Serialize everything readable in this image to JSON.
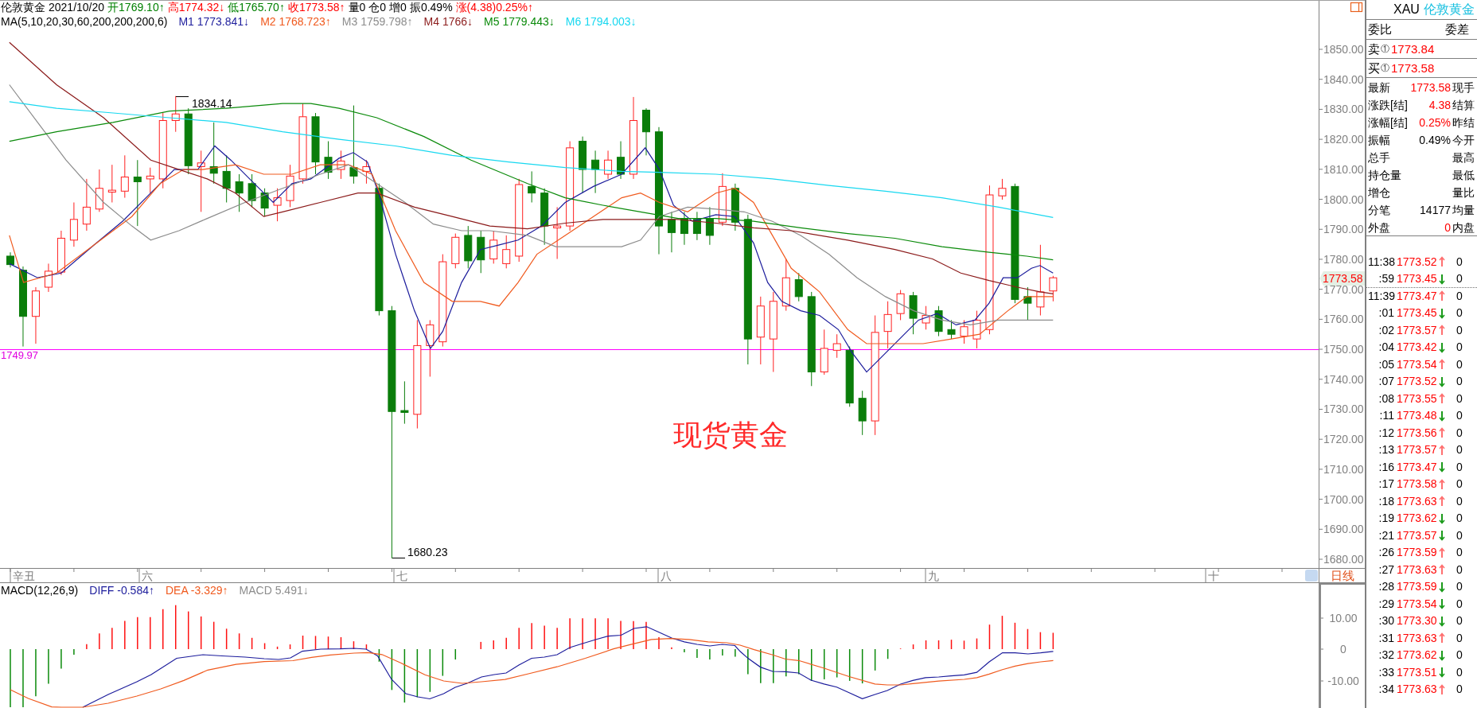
{
  "chart_header": {
    "symbol": "伦敦黄金",
    "date": "2021/10/20",
    "quotes": [
      {
        "text": "开1769.10↑",
        "color": "#008000"
      },
      {
        "text": "高1774.32↓",
        "color": "#ff0000"
      },
      {
        "text": "低1765.70↑",
        "color": "#008000"
      },
      {
        "text": "收1773.58↑",
        "color": "#ff0000"
      },
      {
        "text": "量0",
        "color": "#000000"
      },
      {
        "text": "仓0",
        "color": "#000000"
      },
      {
        "text": "增0",
        "color": "#000000"
      },
      {
        "text": "振0.49%",
        "color": "#000000"
      },
      {
        "text": "涨(4.38)0.25%↑",
        "color": "#ff0000"
      }
    ]
  },
  "ma_legend": {
    "title": "MA(5,10,20,30,60,200,200,200,6)",
    "items": [
      {
        "text": "M1 1773.841↓",
        "color": "#1c1c9c"
      },
      {
        "text": "M2 1768.723↑",
        "color": "#f05a1e"
      },
      {
        "text": "M3 1759.798↑",
        "color": "#8c8c8c"
      },
      {
        "text": "M4 1766↓",
        "color": "#8b1a1a"
      },
      {
        "text": "M5 1779.443↓",
        "color": "#0a8a0a"
      },
      {
        "text": "M6 1794.003↓",
        "color": "#18d8f0"
      }
    ]
  },
  "price_chart": {
    "high_label": "1834.14",
    "low_label": "1680.23",
    "reference_label": "1749.97",
    "title": "现货黄金"
  },
  "price_axis": {
    "labels": [
      "1850.00",
      "1840.00",
      "1830.00",
      "1820.00",
      "1810.00",
      "1800.00",
      "1790.00",
      "1780.00",
      "1770.00",
      "1760.00",
      "1750.00",
      "1740.00",
      "1730.00",
      "1720.00",
      "1710.00",
      "1700.00",
      "1690.00",
      "1680.00"
    ],
    "current_price": "1773.58"
  },
  "date_axis": {
    "labels": [
      "辛丑",
      "六",
      "七",
      "八",
      "九",
      "十"
    ],
    "period": "日线"
  },
  "macd_legend": {
    "title": "MACD(12,26,9)",
    "items": [
      {
        "text": "DIFF -0.584↑",
        "color": "#1c1c9c"
      },
      {
        "text": "DEA -3.329↑",
        "color": "#f05a1e"
      },
      {
        "text": "MACD 5.491↓",
        "color": "#8c8c8c"
      }
    ]
  },
  "macd_axis": {
    "labels": [
      "10.00",
      "0",
      "-10.00"
    ]
  },
  "quote_panel": {
    "symbol": "XAU",
    "name": "伦敦黄金",
    "order_header": [
      "委比",
      "委差"
    ],
    "order_book": [
      {
        "side": "卖",
        "mark": "①",
        "price": "1773.84"
      },
      {
        "side": "买",
        "mark": "①",
        "price": "1773.58"
      }
    ],
    "stats": [
      {
        "label": "最新",
        "value": "1773.58",
        "color": "#ff0000",
        "right_label": "现手"
      },
      {
        "label": "涨跌[结]",
        "value": "4.38",
        "color": "#ff0000",
        "right_label": "结算"
      },
      {
        "label": "涨幅[结]",
        "value": "0.25%",
        "color": "#ff0000",
        "right_label": "昨结"
      },
      {
        "label": "振幅",
        "value": "0.49%",
        "color": "#000000",
        "right_label": "今开"
      },
      {
        "label": "总手",
        "right_label": "最高"
      },
      {
        "label": "持仓量",
        "right_label": "最低"
      },
      {
        "label": "增仓",
        "right_label": "量比"
      },
      {
        "label": "分笔",
        "value": "14177",
        "color": "#000000",
        "right_label": "均量"
      },
      {
        "label": "外盘",
        "value": "0",
        "color": "#ff0000",
        "right_label": "内盘"
      }
    ],
    "ticks": [
      {
        "time": "11:38",
        "price": "1773.52",
        "kind": "up",
        "color": "#ff7070",
        "volume": "0",
        "separated": false
      },
      {
        "time": ":59",
        "price": "1773.45",
        "kind": "down",
        "color": "#1a9a1a",
        "volume": "0",
        "separated": false
      },
      {
        "time": "11:39",
        "price": "1773.47",
        "kind": "up",
        "color": "#ff7070",
        "volume": "0",
        "separated": true
      },
      {
        "time": ":01",
        "price": "1773.45",
        "kind": "down",
        "color": "#1a9a1a",
        "volume": "0",
        "separated": false
      },
      {
        "time": ":02",
        "price": "1773.57",
        "kind": "up",
        "color": "#ff7070",
        "volume": "0",
        "separated": false
      },
      {
        "time": ":04",
        "price": "1773.42",
        "kind": "down",
        "color": "#1a9a1a",
        "volume": "0",
        "separated": false
      },
      {
        "time": ":05",
        "price": "1773.54",
        "kind": "up",
        "color": "#ff7070",
        "volume": "0",
        "separated": false
      },
      {
        "time": ":07",
        "price": "1773.52",
        "kind": "down",
        "color": "#1a9a1a",
        "volume": "0",
        "separated": false
      },
      {
        "time": ":08",
        "price": "1773.55",
        "kind": "up",
        "color": "#ff7070",
        "volume": "0",
        "separated": false
      },
      {
        "time": ":11",
        "price": "1773.48",
        "kind": "down",
        "color": "#1a9a1a",
        "volume": "0",
        "separated": false
      },
      {
        "time": ":12",
        "price": "1773.56",
        "kind": "up",
        "color": "#ff7070",
        "volume": "0",
        "separated": false
      },
      {
        "time": ":13",
        "price": "1773.57",
        "kind": "up",
        "color": "#ff7070",
        "volume": "0",
        "separated": false
      },
      {
        "time": ":16",
        "price": "1773.47",
        "kind": "down",
        "color": "#1a9a1a",
        "volume": "0",
        "separated": false
      },
      {
        "time": ":17",
        "price": "1773.58",
        "kind": "up",
        "color": "#ff7070",
        "volume": "0",
        "separated": false
      },
      {
        "time": ":18",
        "price": "1773.63",
        "kind": "up",
        "color": "#ff7070",
        "volume": "0",
        "separated": false
      },
      {
        "time": ":19",
        "price": "1773.62",
        "kind": "down",
        "color": "#1a9a1a",
        "volume": "0",
        "separated": false
      },
      {
        "time": ":21",
        "price": "1773.57",
        "kind": "down",
        "color": "#1a9a1a",
        "volume": "0",
        "separated": false
      },
      {
        "time": ":26",
        "price": "1773.59",
        "kind": "up",
        "color": "#ff7070",
        "volume": "0",
        "separated": false
      },
      {
        "time": ":27",
        "price": "1773.63",
        "kind": "up",
        "color": "#ff7070",
        "volume": "0",
        "separated": false
      },
      {
        "time": ":28",
        "price": "1773.59",
        "kind": "down",
        "color": "#1a9a1a",
        "volume": "0",
        "separated": false
      },
      {
        "time": ":29",
        "price": "1773.54",
        "kind": "down",
        "color": "#1a9a1a",
        "volume": "0",
        "separated": false
      },
      {
        "time": ":30",
        "price": "1773.30",
        "kind": "down",
        "color": "#1a9a1a",
        "volume": "0",
        "separated": false
      },
      {
        "time": ":31",
        "price": "1773.63",
        "kind": "up",
        "color": "#ff7070",
        "volume": "0",
        "separated": false
      },
      {
        "time": ":32",
        "price": "1773.62",
        "kind": "down",
        "color": "#1a9a1a",
        "volume": "0",
        "separated": false
      },
      {
        "time": ":33",
        "price": "1773.51",
        "kind": "down",
        "color": "#1a9a1a",
        "volume": "0",
        "separated": false
      },
      {
        "time": ":34",
        "price": "1773.63",
        "kind": "up",
        "color": "#ff7070",
        "volume": "0",
        "separated": false
      }
    ]
  }
}
